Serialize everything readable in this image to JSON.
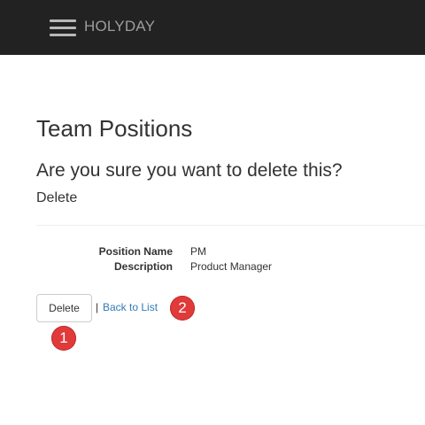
{
  "navbar": {
    "brand": "HOLYDAY",
    "menu_icon": "hamburger-menu-icon",
    "background": "#222222"
  },
  "page": {
    "title": "Team Positions",
    "confirm_question": "Are you sure you want to delete this?",
    "subheading": "Delete"
  },
  "details": [
    {
      "label": "Position Name",
      "value": "PM"
    },
    {
      "label": "Description",
      "value": "Product Manager"
    }
  ],
  "actions": {
    "delete_label": "Delete",
    "separator": "|",
    "back_label": "Back to List"
  },
  "callouts": {
    "one": "1",
    "two": "2",
    "color": "#e03a3a"
  },
  "link_color": "#337ab7"
}
